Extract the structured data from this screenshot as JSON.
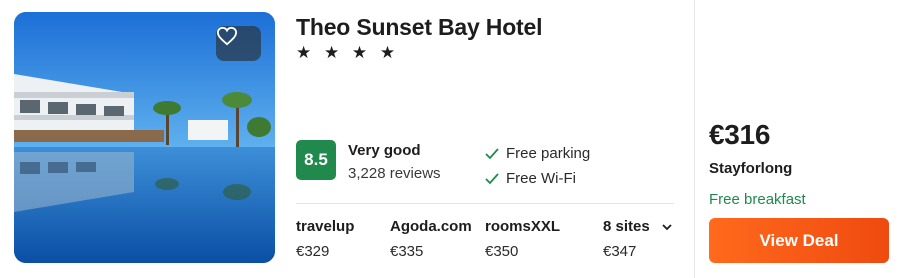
{
  "hotel": {
    "name": "Theo Sunset Bay Hotel",
    "stars": "★ ★ ★ ★"
  },
  "rating": {
    "score": "8.5",
    "label": "Very good",
    "reviews": "3,228 reviews"
  },
  "amenities": [
    "Free parking",
    "Free Wi-Fi"
  ],
  "sites": [
    {
      "name": "travelup",
      "price": "€329"
    },
    {
      "name": "Agoda.com",
      "price": "€335"
    },
    {
      "name": "roomsXXL",
      "price": "€350"
    }
  ],
  "more_sites": {
    "label": "8 sites",
    "price": "€347"
  },
  "best_deal": {
    "price": "€316",
    "provider": "Stayforlong",
    "perk": "Free breakfast",
    "button": "View Deal"
  },
  "colors": {
    "rating_badge": "#1f8a4c",
    "perk_text": "#1f8a4c",
    "deal_button": "#ef4a10"
  },
  "icons": [
    "heart-icon",
    "check-icon",
    "chevron-down-icon"
  ]
}
